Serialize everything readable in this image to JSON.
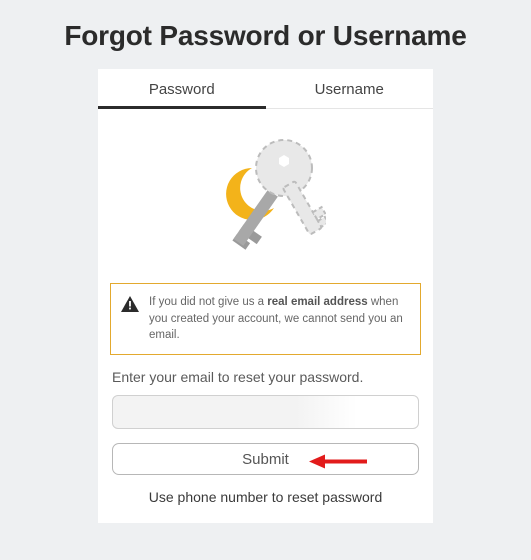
{
  "title": "Forgot Password or Username",
  "tabs": {
    "password": "Password",
    "username": "Username",
    "active": "password"
  },
  "alert": {
    "prefix": "If you did not give us a ",
    "bold": "real email address",
    "suffix": " when you created your account, we cannot send you an email."
  },
  "instruction": "Enter your email to reset your password.",
  "email": {
    "value": "",
    "placeholder": ""
  },
  "submit_label": "Submit",
  "phone_link": "Use phone number to reset password",
  "colors": {
    "accent_border": "#e3a92e"
  }
}
